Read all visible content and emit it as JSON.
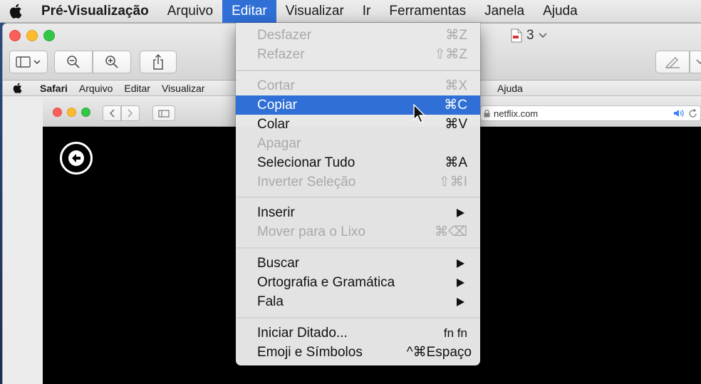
{
  "menubar": {
    "app": "Pré-Visualização",
    "items": [
      "Arquivo",
      "Editar",
      "Visualizar",
      "Ir",
      "Ferramentas",
      "Janela",
      "Ajuda"
    ]
  },
  "preview": {
    "page_count": "3"
  },
  "inner_menubar": {
    "app": "Safari",
    "items": [
      "Arquivo",
      "Editar",
      "Visualizar"
    ],
    "ajuda": "Ajuda"
  },
  "safari": {
    "url": "netflix.com"
  },
  "edit_menu": {
    "items": [
      {
        "label": "Desfazer",
        "shortcut": "⌘Z",
        "state": "disabled"
      },
      {
        "label": "Refazer",
        "shortcut": "⇧⌘Z",
        "state": "disabled"
      },
      {
        "label": "Cortar",
        "shortcut": "⌘X",
        "state": "disabled"
      },
      {
        "label": "Copiar",
        "shortcut": "⌘C",
        "state": "highlighted"
      },
      {
        "label": "Colar",
        "shortcut": "⌘V",
        "state": "enabled"
      },
      {
        "label": "Apagar",
        "shortcut": "",
        "state": "disabled"
      },
      {
        "label": "Selecionar Tudo",
        "shortcut": "⌘A",
        "state": "enabled"
      },
      {
        "label": "Inverter Seleção",
        "shortcut": "⇧⌘I",
        "state": "disabled"
      },
      {
        "label": "Inserir",
        "shortcut": "",
        "state": "submenu"
      },
      {
        "label": "Mover para o Lixo",
        "shortcut": "⌘⌫",
        "state": "disabled"
      },
      {
        "label": "Buscar",
        "shortcut": "",
        "state": "submenu"
      },
      {
        "label": "Ortografia e Gramática",
        "shortcut": "",
        "state": "submenu"
      },
      {
        "label": "Fala",
        "shortcut": "",
        "state": "submenu"
      },
      {
        "label": "Iniciar Ditado...",
        "shortcut": "fn fn",
        "state": "enabled"
      },
      {
        "label": "Emoji e Símbolos",
        "shortcut": "^⌘Espaço",
        "state": "enabled"
      }
    ]
  },
  "colors": {
    "highlight": "#2f6fd6",
    "disabled_text": "#a9a9a9"
  }
}
